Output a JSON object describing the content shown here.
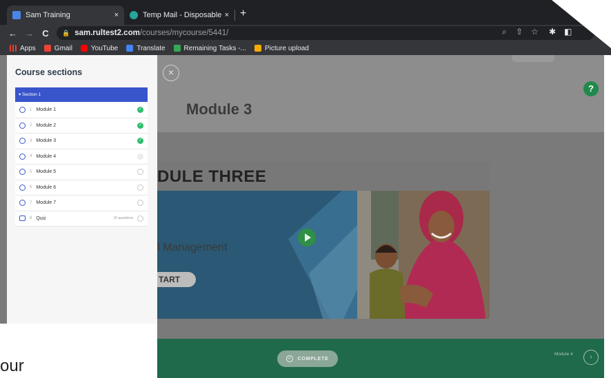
{
  "browser": {
    "tabs": [
      {
        "title": "Sam Training",
        "close": "×",
        "favicon_color": "#4a86e8"
      },
      {
        "title": "Temp Mail - Disposable Tempo",
        "close": "×",
        "favicon_color": "#26a69a"
      }
    ],
    "new_tab": "+",
    "nav": {
      "back": "←",
      "forward": "→",
      "reload": "C"
    },
    "url_host": "sam.rultest2.com",
    "url_path": "/courses/mycourse/5441/",
    "bookmarks": [
      {
        "label": "Apps",
        "color": "#e94235"
      },
      {
        "label": "Gmail",
        "color": "#ea4335"
      },
      {
        "label": "YouTube",
        "color": "#ff0000"
      },
      {
        "label": "Translate",
        "color": "#4285f4"
      },
      {
        "label": "Remaining Tasks -...",
        "color": "#34a853"
      },
      {
        "label": "Picture upload",
        "color": "#f9ab00"
      }
    ]
  },
  "sidebar": {
    "title": "Course sections",
    "section": "▾ Section 1",
    "modules": [
      {
        "num": "1",
        "name": "Module 1",
        "meta": "",
        "status": "done"
      },
      {
        "num": "2",
        "name": "Module 2",
        "meta": "",
        "status": "done"
      },
      {
        "num": "3",
        "name": "Module 3",
        "meta": "",
        "status": "done"
      },
      {
        "num": "4",
        "name": "Module 4",
        "meta": "",
        "status": "empty"
      },
      {
        "num": "5",
        "name": "Module 5",
        "meta": "",
        "status": "pending"
      },
      {
        "num": "6",
        "name": "Module 6",
        "meta": "",
        "status": "pending"
      },
      {
        "num": "7",
        "name": "Module 7",
        "meta": "",
        "status": "pending"
      },
      {
        "num": "8",
        "name": "Quiz",
        "meta": "10 questions",
        "status": "pending"
      }
    ]
  },
  "main": {
    "heading": "Module 3",
    "help": "?",
    "close": "×",
    "video": {
      "title": "DULE THREE",
      "subtitle": "l Management",
      "start": "TART"
    },
    "complete": "COMPLETE",
    "next_label": "Module 4",
    "next": "›"
  },
  "corner_text": "our",
  "colors": {
    "accent_blue": "#3855cc",
    "done_green": "#2ebd6b",
    "bar_green": "#1f6a4b"
  }
}
